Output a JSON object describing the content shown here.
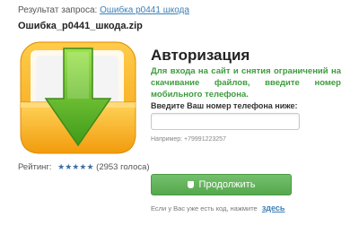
{
  "search": {
    "prefix": "Результат запроса:",
    "query_link": "Ошибка p0441 шкода"
  },
  "file": {
    "name": "Ошибка_p0441_шкода.zip"
  },
  "rating": {
    "label": "Рейтинг:",
    "stars": "★★★★★",
    "votes": "(2953 голоса)",
    "value": 5
  },
  "auth": {
    "title": "Авторизация",
    "description": "Для входа на сайт и снятия ограничений на скачивание файлов, введите номер мобильного телефона.",
    "phone_label": "Введите Ваш номер телефона ниже:",
    "phone_value": "",
    "example": "Например: +79991223257",
    "continue_label": "Продолжить",
    "code_note": "Если у Вас уже есть код, нажмите",
    "code_link": "здесь"
  },
  "colors": {
    "folder": "#f6a417",
    "arrow": "#5cb82a",
    "button": "#5bae52",
    "link": "#3a7fb8",
    "desc_green": "#3d9c3d"
  },
  "icons": {
    "download": "download-folder-icon",
    "button": "lock-icon"
  }
}
